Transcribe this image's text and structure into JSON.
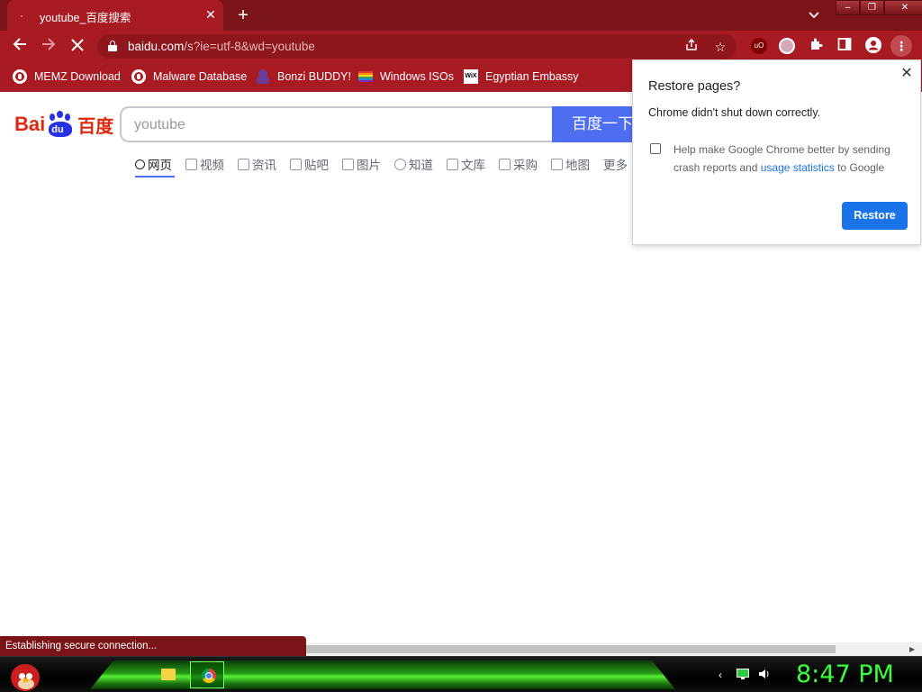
{
  "browser": {
    "tab_title": "youtube_百度搜索",
    "url_host": "baidu.com",
    "url_path": "/s?ie=utf-8&wd=youtube"
  },
  "bookmarks": [
    {
      "label": "MEMZ Download",
      "icon": "globe-icon"
    },
    {
      "label": "Malware Database",
      "icon": "globe-icon"
    },
    {
      "label": "Bonzi BUDDY!",
      "icon": "bonzi-icon"
    },
    {
      "label": "Windows ISOs",
      "icon": "rainbow-flag-icon"
    },
    {
      "label": "Egyptian Embassy",
      "icon": "wix-icon"
    }
  ],
  "extensions": [
    {
      "label": "uO",
      "color": "#800000"
    },
    {
      "label": "",
      "color": "#d7a9b8"
    }
  ],
  "page": {
    "logo_text": "Bai",
    "logo_du": "du",
    "logo_cn": "百度",
    "search_value": "youtube",
    "search_button": "百度一下",
    "nav_tabs": [
      "网页",
      "视频",
      "资讯",
      "贴吧",
      "图片",
      "知道",
      "文库",
      "采购",
      "地图",
      "更多"
    ]
  },
  "popup": {
    "title": "Restore pages?",
    "message": "Chrome didn't shut down correctly.",
    "help_prefix": "Help make Google Chrome better by sending crash reports and ",
    "help_link": "usage statistics",
    "help_suffix": " to Google",
    "restore_label": "Restore"
  },
  "status": {
    "text": "Establishing secure connection..."
  },
  "taskbar": {
    "clock": "8:47 PM"
  },
  "colors": {
    "chrome_frame": "#7a1418",
    "chrome_toolbar": "#a91b22",
    "baidu_blue": "#4e6ef2",
    "baidu_red": "#de2910",
    "clock_green": "#3cff3c"
  }
}
